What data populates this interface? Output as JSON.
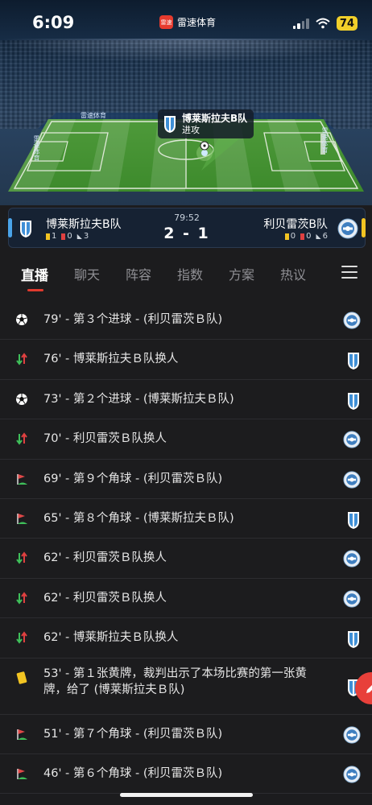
{
  "status_bar": {
    "time": "6:09",
    "app_name": "雷速体育",
    "app_logo_text": "雷速",
    "battery": "74"
  },
  "stadium": {
    "ad_boards": [
      "雷速体育",
      "雷速体育",
      "雷速体育"
    ],
    "event_popup": {
      "team": "博莱斯拉夫B队",
      "event": "进攻"
    }
  },
  "scoreboard": {
    "minute": "79:52",
    "score": "2 - 1",
    "home": {
      "name": "博莱斯拉夫B队",
      "yellow": "1",
      "red": "0",
      "corners": "3"
    },
    "away": {
      "name": "利贝雷茨B队",
      "yellow": "0",
      "red": "0",
      "corners": "6"
    },
    "colors": {
      "home": "#4aa3e8",
      "away": "#f2c422"
    }
  },
  "tabs": [
    "直播",
    "聊天",
    "阵容",
    "指数",
    "方案",
    "热议"
  ],
  "events": [
    {
      "icon": "ball-icon",
      "text": "79' - 第３个进球 - (利贝雷茨Ｂ队)",
      "team": "away"
    },
    {
      "icon": "substitution-icon",
      "text": "76' - 博莱斯拉夫Ｂ队换人",
      "team": "home"
    },
    {
      "icon": "ball-icon",
      "text": "73' - 第２个进球 - (博莱斯拉夫Ｂ队)",
      "team": "home"
    },
    {
      "icon": "substitution-icon",
      "text": "70' - 利贝雷茨Ｂ队换人",
      "team": "away"
    },
    {
      "icon": "corner-flag-icon",
      "text": "69' - 第９个角球 - (利贝雷茨Ｂ队)",
      "team": "away"
    },
    {
      "icon": "corner-flag-icon",
      "text": "65' - 第８个角球 - (博莱斯拉夫Ｂ队)",
      "team": "home"
    },
    {
      "icon": "substitution-icon",
      "text": "62' - 利贝雷茨Ｂ队换人",
      "team": "away"
    },
    {
      "icon": "substitution-icon",
      "text": "62' - 利贝雷茨Ｂ队换人",
      "team": "away"
    },
    {
      "icon": "substitution-icon",
      "text": "62' - 博莱斯拉夫Ｂ队换人",
      "team": "home"
    },
    {
      "icon": "yellow-card-icon",
      "text": "53' - 第１张黄牌，裁判出示了本场比赛的第一张黄牌，给了 (博莱斯拉夫Ｂ队)",
      "team": "home"
    },
    {
      "icon": "corner-flag-icon",
      "text": "51' - 第７个角球 - (利贝雷茨Ｂ队)",
      "team": "away"
    },
    {
      "icon": "corner-flag-icon",
      "text": "46' - 第６个角球 - (利贝雷茨Ｂ队)",
      "team": "away"
    }
  ]
}
